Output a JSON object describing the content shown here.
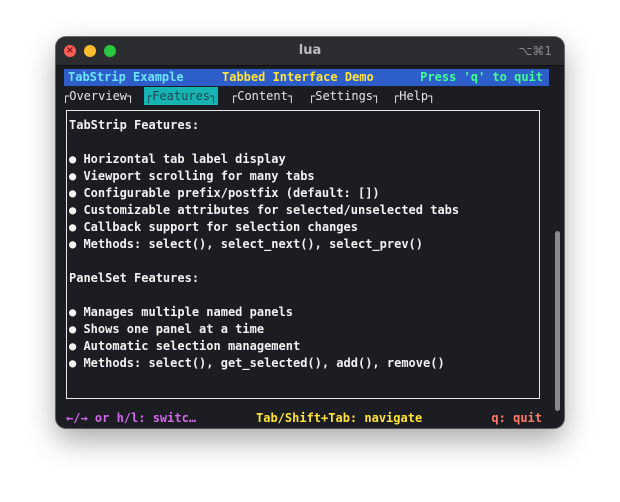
{
  "window": {
    "title": "lua",
    "shortcut": "⌥⌘1",
    "close_glyph": "×"
  },
  "header": {
    "left": "TabStrip Example",
    "center": "Tabbed Interface Demo",
    "right": "Press 'q' to quit"
  },
  "tabs": [
    {
      "label": "┌Overview┐",
      "selected": false
    },
    {
      "label": "┌Features┐",
      "selected": true
    },
    {
      "label": "┌Content┐",
      "selected": false
    },
    {
      "label": "┌Settings┐",
      "selected": false
    },
    {
      "label": "┌Help┐",
      "selected": false
    }
  ],
  "content": {
    "lines": [
      "TabStrip Features:",
      "",
      "● Horizontal tab label display",
      "● Viewport scrolling for many tabs",
      "● Configurable prefix/postfix (default: [])",
      "● Customizable attributes for selected/unselected tabs",
      "● Callback support for selection changes",
      "● Methods: select(), select_next(), select_prev()",
      "",
      "PanelSet Features:",
      "",
      "● Manages multiple named panels",
      "● Shows one panel at a time",
      "● Automatic selection management",
      "● Methods: select(), get_selected(), add(), remove()"
    ]
  },
  "status": {
    "left": "←/→ or h/l: switc…",
    "center": "Tab/Shift+Tab: navigate",
    "right": "q: quit"
  },
  "colors": {
    "background": "#1c1d22",
    "header_bg": "#2d5ec9",
    "selected_tab_bg": "#17b2b2"
  }
}
